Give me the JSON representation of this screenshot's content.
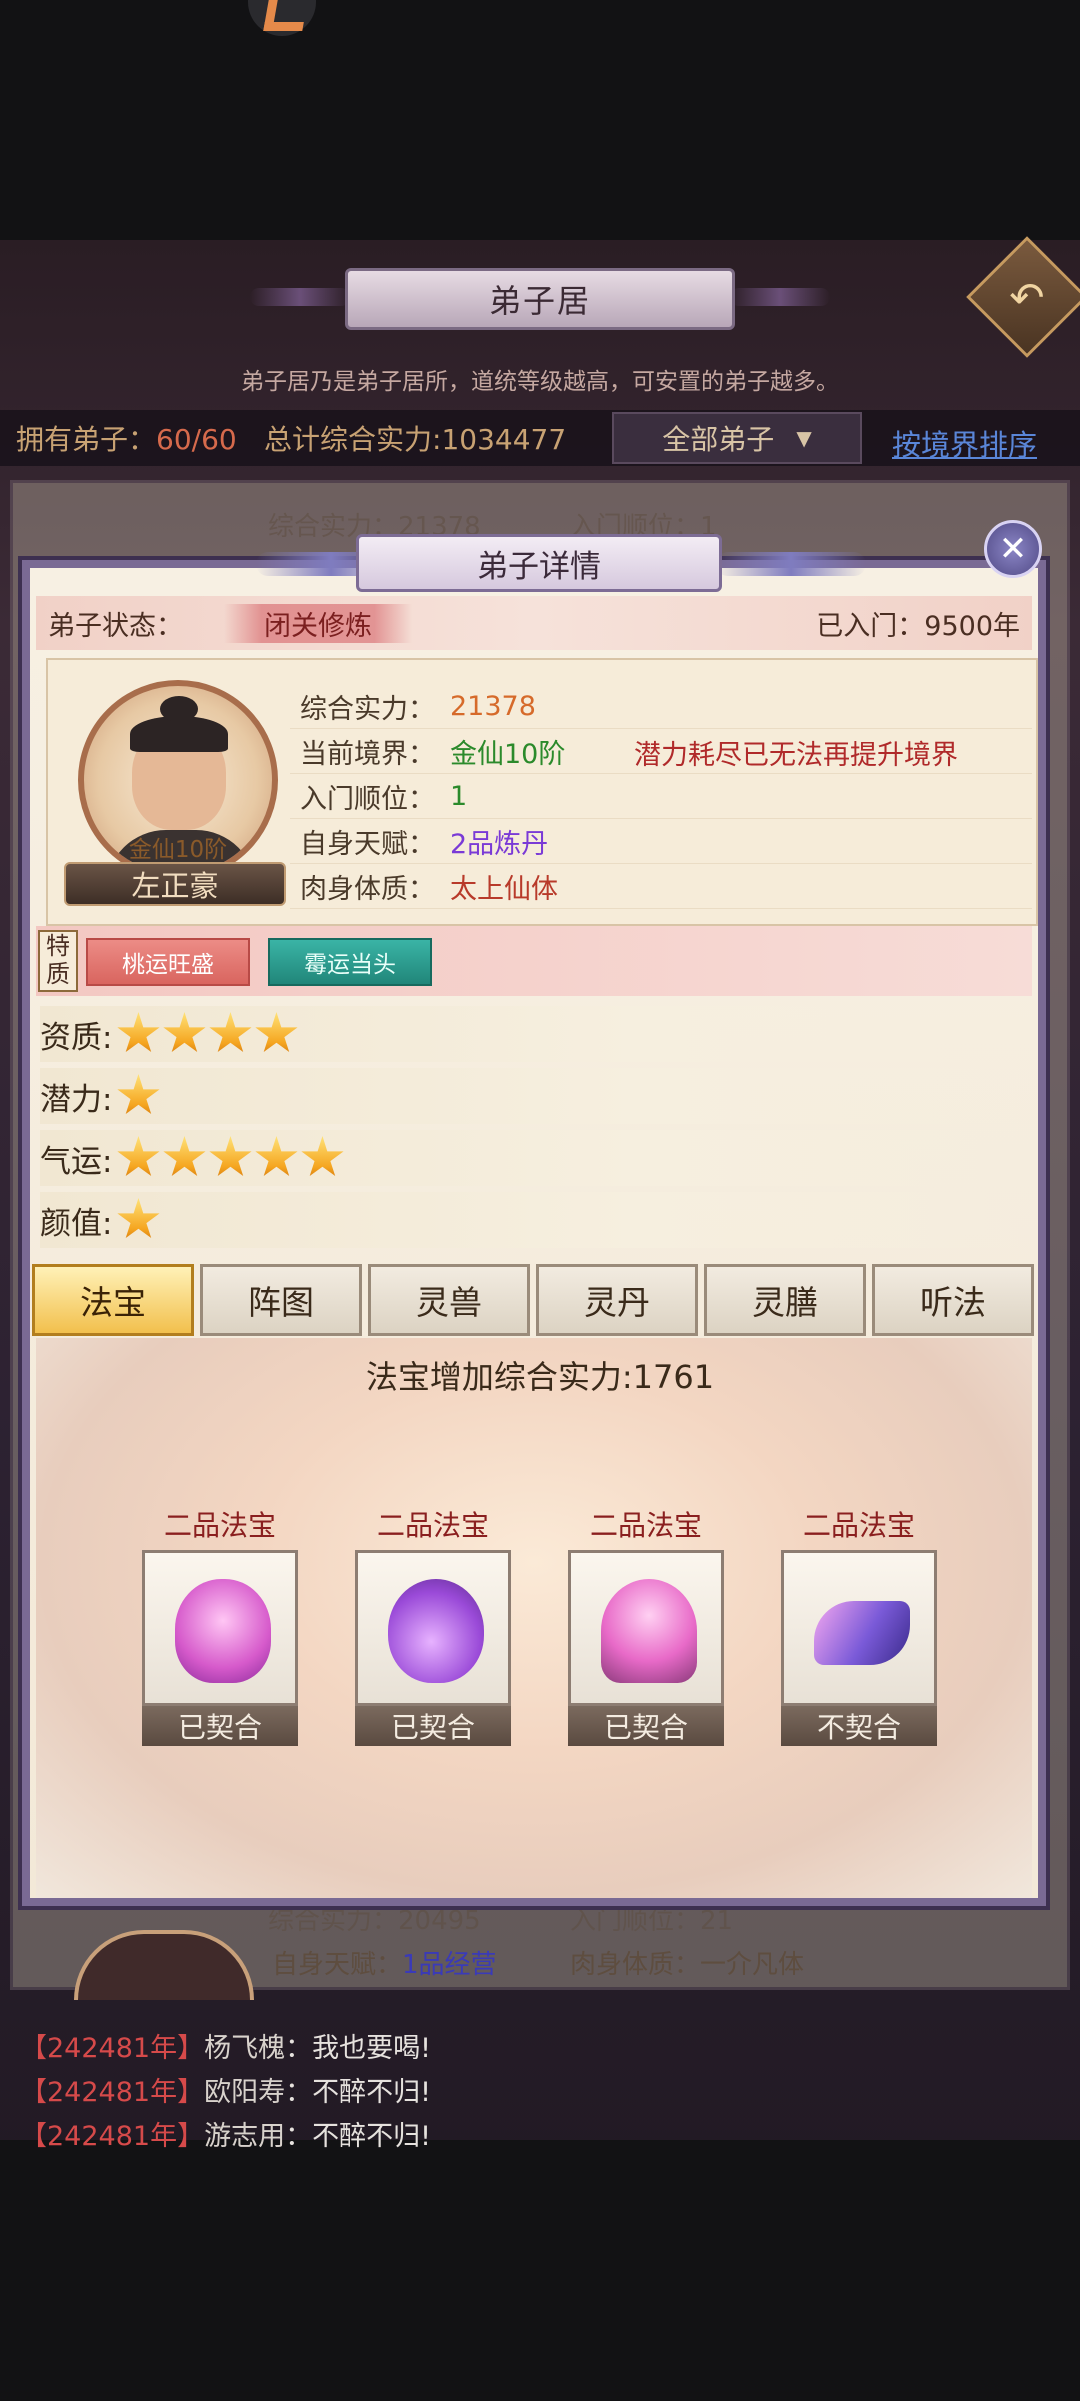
{
  "header": {
    "title": "弟子居",
    "intro": "弟子居乃是弟子居所，道统等级越高，可安置的弟子越多。"
  },
  "info_bar": {
    "own_label": "拥有弟子：",
    "own_count": "60/60",
    "power_label": "总计综合实力:",
    "power_value": "1034477",
    "filter_value": "全部弟子",
    "sort_label": "按境界排序"
  },
  "background_list": {
    "row1_power": "综合实力：21378",
    "row1_order": "入门顺位：1",
    "row2_power": "综合实力：20495",
    "row2_order": "入门顺位：21",
    "row2_talent_label": "自身天赋：",
    "row2_talent_value": "1品经营",
    "row2_physique": "肉身体质：一介凡体"
  },
  "modal": {
    "title": "弟子详情",
    "status_label": "弟子状态：",
    "status_value": "闭关修炼",
    "years_label": "已入门：",
    "years_value": "9500年",
    "avatar_realm": "金仙10阶",
    "name": "左正豪",
    "stats": [
      {
        "label": "综合实力：",
        "value": "21378",
        "color": "#d66a2a"
      },
      {
        "label": "当前境界：",
        "value": "金仙10阶",
        "color": "#2b8a2b"
      },
      {
        "label": "入门顺位：",
        "value": "1",
        "color": "#2b8a2b"
      },
      {
        "label": "自身天赋：",
        "value": "2品炼丹",
        "color": "#7a3ad6"
      },
      {
        "label": "肉身体质：",
        "value": "太上仙体",
        "color": "#b83a2a"
      }
    ],
    "warning": "潜力耗尽已无法再提升境界",
    "trait_tag": "特质",
    "traits": [
      "桃运旺盛",
      "霉运当头"
    ],
    "attributes": [
      {
        "label": "资质:",
        "stars": 4
      },
      {
        "label": "潜力:",
        "stars": 1
      },
      {
        "label": "气运:",
        "stars": 5
      },
      {
        "label": "颜值:",
        "stars": 1
      }
    ],
    "tabs": [
      "法宝",
      "阵图",
      "灵兽",
      "灵丹",
      "灵膳",
      "听法"
    ],
    "active_tab": "法宝",
    "bonus_label": "法宝增加综合实力:",
    "bonus_value": "1761",
    "items": [
      {
        "grade": "二品法宝",
        "status": "已契合",
        "icon": "bell-treasure-icon"
      },
      {
        "grade": "二品法宝",
        "status": "已契合",
        "icon": "gourd-treasure-icon"
      },
      {
        "grade": "二品法宝",
        "status": "已契合",
        "icon": "lotus-treasure-icon"
      },
      {
        "grade": "二品法宝",
        "status": "不契合",
        "icon": "ribbon-treasure-icon"
      }
    ]
  },
  "chat": [
    {
      "year": "【242481年】",
      "name": "杨飞槐",
      "text": "：我也要喝!"
    },
    {
      "year": "【242481年】",
      "name": "欧阳寿",
      "text": "：不醉不归!"
    },
    {
      "year": "【242481年】",
      "name": "游志用",
      "text": "：不醉不归!"
    }
  ]
}
